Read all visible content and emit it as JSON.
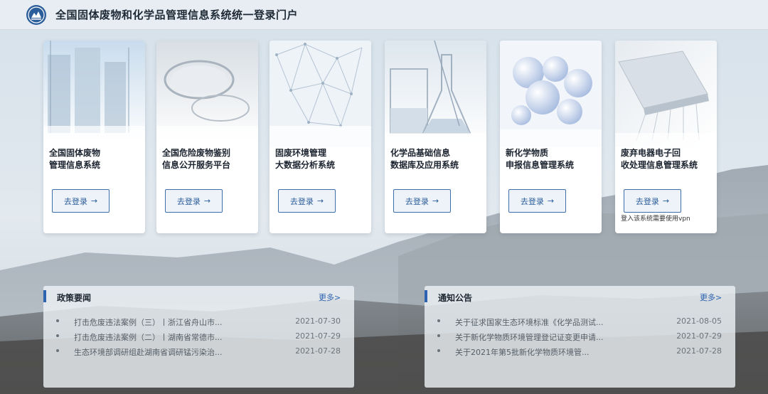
{
  "header": {
    "title": "全国固体废物和化学品管理信息系统统一登录门户",
    "logo_icon": "ministry-emblem-icon"
  },
  "cards": [
    {
      "line1": "全国固体废物",
      "line2": "管理信息系统",
      "button": "去登录",
      "image": "storage-tanks-image"
    },
    {
      "line1": "全国危险废物鉴别",
      "line2": "信息公开服务平台",
      "button": "去登录",
      "image": "petri-dish-image"
    },
    {
      "line1": "固废环境管理",
      "line2": "大数据分析系统",
      "button": "去登录",
      "image": "network-sphere-image"
    },
    {
      "line1": "化学品基础信息",
      "line2": "数据库及应用系统",
      "button": "去登录",
      "image": "lab-glassware-image"
    },
    {
      "line1": "新化学物质",
      "line2": "申报信息管理系统",
      "button": "去登录",
      "image": "molecule-spheres-image"
    },
    {
      "line1": "废弃电器电子回",
      "line2": "收处理信息管理系统",
      "button": "去登录",
      "image": "circuit-chip-image",
      "note": "登入该系统需要使用vpn"
    }
  ],
  "policy": {
    "title": "政策要闻",
    "more": "更多>",
    "items": [
      {
        "text": "打击危废违法案例（三）丨浙江省舟山市...",
        "date": "2021-07-30"
      },
      {
        "text": "打击危废违法案例（二）丨湖南省常德市...",
        "date": "2021-07-29"
      },
      {
        "text": "生态环境部调研组赴湖南省调研锰污染治...",
        "date": "2021-07-28"
      }
    ]
  },
  "notice": {
    "title": "通知公告",
    "more": "更多>",
    "items": [
      {
        "text": "关于征求国家生态环境标准《化学品测试...",
        "date": "2021-08-05"
      },
      {
        "text": "关于新化学物质环境管理登记证变更申请...",
        "date": "2021-07-29"
      },
      {
        "text": "关于2021年第5批新化学物质环境管...",
        "date": "2021-07-28"
      }
    ]
  },
  "colors": {
    "accent": "#2d63b0",
    "button_border": "#3f6fa8",
    "title_text": "#1e2a36"
  }
}
